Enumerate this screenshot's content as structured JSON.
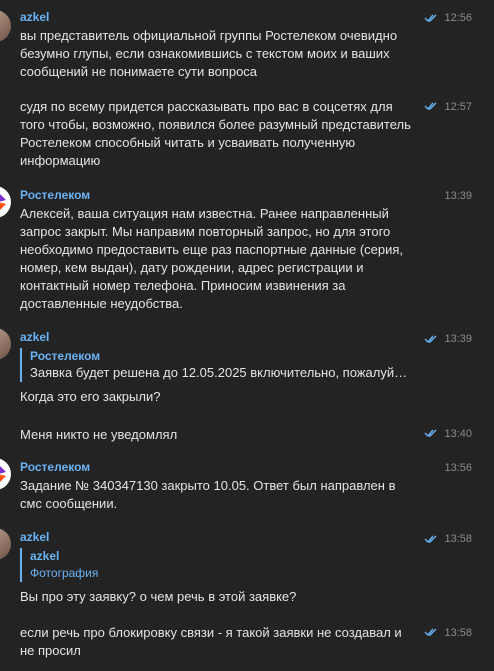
{
  "messages": [
    {
      "sender": "azkel",
      "text": "вы представитель официальной группы Ростелеком очевидно безумно глупы, если ознакомившись с текстом моих и ваших сообщений не понимаете сути вопроса",
      "time": "12:56",
      "status": "read"
    },
    {
      "text": "судя по всему придется рассказывать про вас в соцсетях для того чтобы, возможно, появился более разумный представитель Ростелеком способный читать и усваивать полученную информацию",
      "time": "12:57",
      "status": "read"
    },
    {
      "sender": "Ростелеком",
      "text": "Алексей, ваша ситуация нам известна. Ранее направленный запрос закрыт. Мы направим повторный запрос, но  для этого необходимо предоставить еще раз паспортные данные (серия, номер, кем выдан), дату рождении, адрес регистрации и контактный номер телефона. Приносим извинения за доставленные неудобства.",
      "time": "13:39"
    },
    {
      "sender": "azkel",
      "reply_to": {
        "sender": "Ростелеком",
        "text": "Заявка будет решена до 12.05.2025 включительно, пожалуй…"
      },
      "text": "Когда это его закрыли?",
      "time": "13:39",
      "status": "read"
    },
    {
      "text": "Меня никто не уведомлял",
      "time": "13:40",
      "status": "read"
    },
    {
      "sender": "Ростелеком",
      "text": "Задание № 340347130 закрыто 10.05. Ответ был направлен в смс сообщении.",
      "time": "13:56"
    },
    {
      "sender": "azkel",
      "reply_to": {
        "sender": "azkel",
        "text": "Фотография"
      },
      "text": "Вы про эту заявку? о чем речь в этой заявке?",
      "time": "13:58",
      "status": "read"
    },
    {
      "text": "если речь про блокировку связи - я такой заявки не создавал и не просил",
      "time": "13:58",
      "status": "read"
    }
  ],
  "colors": {
    "background": "#232323",
    "name": "#6ab2f2",
    "text": "#e4e4e4",
    "time": "#8a8a8a",
    "rostelecom_purple": "#7b2fd0"
  }
}
